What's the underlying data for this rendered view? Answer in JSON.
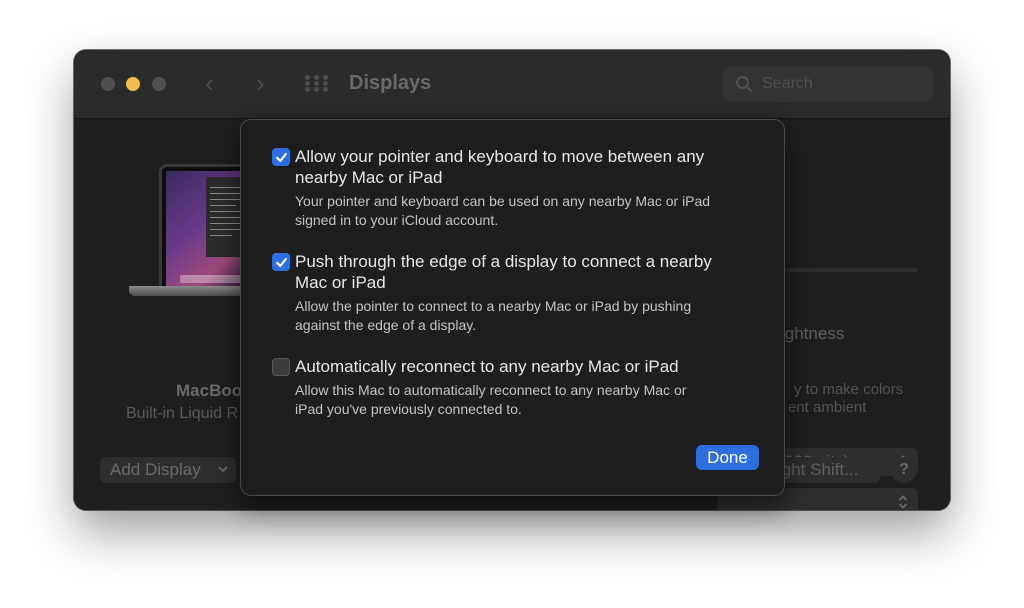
{
  "window": {
    "title": "Displays",
    "search_placeholder": "Search"
  },
  "display": {
    "name": "MacBoo",
    "subtitle": "Built-in Liquid R"
  },
  "background": {
    "brightness_label": "ightness",
    "description_line1": "y to make colors",
    "description_line2": "ent ambient",
    "preset_value": "600 nits)",
    "add_display_label": "Add Display",
    "night_shift_label": "ight Shift...",
    "help_label": "?"
  },
  "sheet": {
    "options": [
      {
        "checked": true,
        "label_line1": "Allow your pointer and keyboard to move between any",
        "label_line2": "nearby Mac or iPad",
        "desc_line1": "Your pointer and keyboard can be used on any nearby Mac or iPad",
        "desc_line2": "signed in to your iCloud account."
      },
      {
        "checked": true,
        "label_line1": "Push through the edge of a display to connect a nearby",
        "label_line2": "Mac or iPad",
        "desc_line1": "Allow the pointer to connect to a nearby Mac or iPad by pushing",
        "desc_line2": "against the edge of a display."
      },
      {
        "checked": false,
        "label_line1": "Automatically reconnect to any nearby Mac or iPad",
        "desc_line1": "Allow this Mac to automatically reconnect to any nearby Mac or",
        "desc_line2": "iPad you've previously connected to."
      }
    ],
    "done_label": "Done"
  },
  "colors": {
    "accent": "#2f6ee0",
    "window_bg": "#1f1f1f",
    "sheet_bg": "#1e1e1e",
    "minimize_yellow": "#f4bc4f"
  }
}
